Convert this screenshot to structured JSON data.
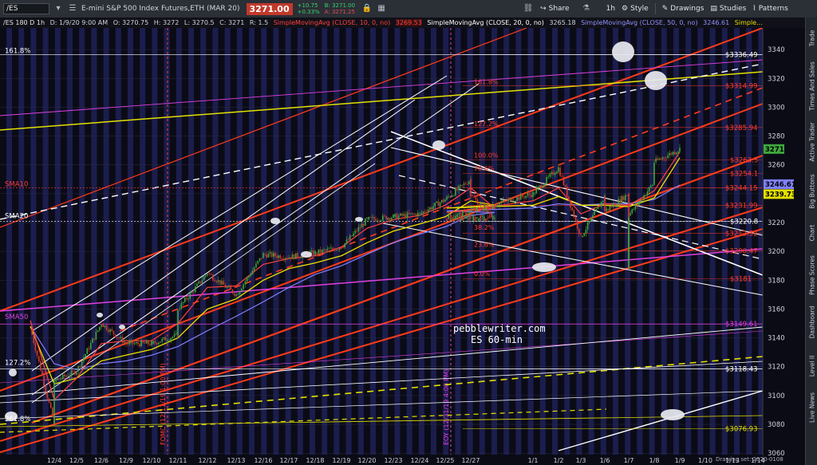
{
  "toolbar": {
    "symbol": "/ES",
    "description": "E-mini S&P 500 Index Futures,ETH (MAR 20)",
    "last_price": "3271.00",
    "change_abs": "+10.75",
    "change_pct": "+0.33%",
    "bid": "B: 3271.00",
    "ask": "A: 3271.25",
    "share": "Share",
    "timeframe": "1h",
    "style": "Style",
    "drawings": "Drawings",
    "studies": "Studies",
    "patterns": "Patterns"
  },
  "infobar": {
    "symbol_period": "/ES 180 D 1h",
    "datetime": "D: 1/9/20 9:00 AM",
    "open": "O: 3270.75",
    "high": "H: 3272",
    "low": "L: 3270.5",
    "close": "C: 3271",
    "range": "R: 1.5",
    "sma10": "SimpleMovingAvg (CLOSE, 10, 0, no)",
    "sma10_val": "3269.53",
    "sma20": "SimpleMovingAvg (CLOSE, 20, 0, no)",
    "sma20_val": "3265.18",
    "sma50": "SimpleMovingAvg (CLOSE, 50, 0, no)",
    "sma50_val": "3246.61",
    "sma_more": "Simple..."
  },
  "sidebar_tabs": [
    "Trade",
    "Times And Sales",
    "Active Trader",
    "Big Buttons",
    "Chart",
    "Phase Scores",
    "Dashboard",
    "Level II",
    "Live News"
  ],
  "status": "Drawing set: 2020-0108",
  "colors": {
    "background": "#0b0b16",
    "band": "#1f2157",
    "sma10": "#ff4040",
    "sma20": "#f0e000",
    "sma50": "#8080ff",
    "channel_red": "#ff3b1a",
    "fib": "#ff3b30",
    "magenta": "#e040e0",
    "yellow_line": "#e3e000",
    "up_candle": "#3ea83e",
    "down_candle": "#d23b2b"
  },
  "chart_data": {
    "type": "candlestick",
    "xlim": [
      "12/4",
      "1/21"
    ],
    "ylim": [
      3059,
      3355
    ],
    "x_tick_labels": [
      "12/4",
      "12/5",
      "12/6",
      "12/9",
      "12/10",
      "12/11",
      "12/12",
      "12/13",
      "12/16",
      "12/17",
      "12/18",
      "12/19",
      "12/20",
      "12/23",
      "12/24",
      "12/25",
      "12/27",
      "1/1",
      "1/2",
      "1/3",
      "1/6",
      "1/7",
      "1/8",
      "1/9",
      "1/10",
      "1/13",
      "1/14",
      "1/15",
      "1/16",
      "1/17",
      "1/20",
      "1/21"
    ],
    "y_ticks": [
      3060,
      3080,
      3100,
      3120,
      3140,
      3160,
      3180,
      3200,
      3220,
      3240,
      3260,
      3280,
      3300,
      3320,
      3340
    ],
    "price_markers": [
      {
        "label": "$3336.49",
        "value": 3336.49,
        "color": "#ffffff"
      },
      {
        "label": "$3314.99",
        "value": 3314.99,
        "color": "#ff3b30"
      },
      {
        "label": "$3285.94",
        "value": 3285.94,
        "color": "#ff3b30"
      },
      {
        "label": "$3263.5",
        "value": 3263.5,
        "color": "#ff3b30"
      },
      {
        "label": "$3254.1",
        "value": 3254.1,
        "color": "#ff3b30"
      },
      {
        "label": "$3244.15",
        "value": 3244.15,
        "color": "#ff3b30"
      },
      {
        "label": "$3231.99",
        "value": 3231.99,
        "color": "#ff3b30"
      },
      {
        "label": "$3220.8",
        "value": 3220.8,
        "color": "#ffffff"
      },
      {
        "label": "$3212.52",
        "value": 3212.52,
        "color": "#ff3b30"
      },
      {
        "label": "$3200.47",
        "value": 3200.47,
        "color": "#ff3b30"
      },
      {
        "label": "$3181",
        "value": 3181,
        "color": "#ff3b30"
      },
      {
        "label": "$3149.61",
        "value": 3149.61,
        "color": "#e040e0"
      },
      {
        "label": "$3118.43",
        "value": 3118.43,
        "color": "#ffffff"
      },
      {
        "label": "$3076.93",
        "value": 3076.93,
        "color": "#e3e000"
      }
    ],
    "current_price_tags": [
      {
        "label": "3271",
        "value": 3271,
        "color": "#3ea83e"
      },
      {
        "label": "3246.61",
        "value": 3246.61,
        "color": "#8080ff"
      },
      {
        "label": "3239.73",
        "value": 3239.73,
        "color": "#e3e000"
      }
    ],
    "left_labels": [
      {
        "text": "161.8%",
        "value": 3336.49,
        "color": "#ffffff"
      },
      {
        "text": "SMA10",
        "value": 3244.15,
        "color": "#ff3b30"
      },
      {
        "text": "SMA20",
        "value": 3222,
        "color": "#ffffff"
      },
      {
        "text": "SMA50",
        "value": 3152,
        "color": "#e040e0"
      },
      {
        "text": "127.2%",
        "value": 3120,
        "color": "#ffffff"
      },
      {
        "text": "261.8%",
        "value": 3081,
        "color": "#ffffff"
      }
    ],
    "fib_labels": [
      {
        "text": "161.8%",
        "x": "1/1",
        "value": 3316
      },
      {
        "text": "127.2%",
        "x": "1/1",
        "value": 3287
      },
      {
        "text": "100.0%",
        "x": "1/1",
        "value": 3265
      },
      {
        "text": "78.6%",
        "x": "1/1",
        "value": 3256
      },
      {
        "text": "38.2%",
        "x": "1/1",
        "value": 3215
      },
      {
        "text": "23.6%",
        "x": "1/1",
        "value": 3203
      },
      {
        "text": "0.0%",
        "x": "1/1",
        "value": 3183
      }
    ],
    "vertical_markers": [
      {
        "label": "FOMC (12/11/19 1:00 PM)",
        "x": "12/11",
        "color": "#ff3b30"
      },
      {
        "label": "EOY (12/31/19 4:00 PM)",
        "x": "12/31",
        "color": "#e040e0"
      }
    ],
    "annotations": [
      "pebblewriter.com",
      "ES 60-min"
    ],
    "price_path": [
      [
        "12/3",
        3147
      ],
      [
        "12/4",
        3080
      ],
      [
        "12/4",
        3110
      ],
      [
        "12/5",
        3117
      ],
      [
        "12/6",
        3150
      ],
      [
        "12/9",
        3136
      ],
      [
        "12/10",
        3136
      ],
      [
        "12/11",
        3142
      ],
      [
        "12/11",
        3160
      ],
      [
        "12/12",
        3185
      ],
      [
        "12/13",
        3170
      ],
      [
        "12/16",
        3198
      ],
      [
        "12/17",
        3196
      ],
      [
        "12/18",
        3199
      ],
      [
        "12/19",
        3203
      ],
      [
        "12/20",
        3222
      ],
      [
        "12/23",
        3224
      ],
      [
        "12/24",
        3226
      ],
      [
        "12/25",
        3236
      ],
      [
        "12/27",
        3250
      ],
      [
        "12/27",
        3239
      ],
      [
        "12/30",
        3223
      ],
      [
        "12/31",
        3223
      ],
      [
        "1/1",
        3240
      ],
      [
        "1/2",
        3258
      ],
      [
        "1/3",
        3210
      ],
      [
        "1/6",
        3238
      ],
      [
        "1/6",
        3228
      ],
      [
        "1/7",
        3240
      ],
      [
        "1/7",
        3188
      ],
      [
        "1/7",
        3225
      ],
      [
        "1/8",
        3248
      ],
      [
        "1/8",
        3262
      ],
      [
        "1/9",
        3271
      ]
    ],
    "sma10": [
      [
        "12/3",
        3152
      ],
      [
        "12/4",
        3097
      ],
      [
        "12/5",
        3112
      ],
      [
        "12/6",
        3136
      ],
      [
        "12/9",
        3138
      ],
      [
        "12/10",
        3138
      ],
      [
        "12/11",
        3150
      ],
      [
        "12/12",
        3175
      ],
      [
        "12/13",
        3176
      ],
      [
        "12/16",
        3191
      ],
      [
        "12/17",
        3195
      ],
      [
        "12/18",
        3197
      ],
      [
        "12/19",
        3203
      ],
      [
        "12/20",
        3216
      ],
      [
        "12/23",
        3222
      ],
      [
        "12/24",
        3225
      ],
      [
        "12/25",
        3232
      ],
      [
        "12/27",
        3244
      ],
      [
        "12/30",
        3230
      ],
      [
        "12/31",
        3227
      ],
      [
        "1/1",
        3235
      ],
      [
        "1/2",
        3244
      ],
      [
        "1/3",
        3226
      ],
      [
        "1/6",
        3233
      ],
      [
        "1/7",
        3232
      ],
      [
        "1/8",
        3242
      ],
      [
        "1/9",
        3269
      ]
    ],
    "sma20": [
      [
        "12/3",
        3148
      ],
      [
        "12/4",
        3108
      ],
      [
        "12/5",
        3112
      ],
      [
        "12/6",
        3124
      ],
      [
        "12/9",
        3128
      ],
      [
        "12/10",
        3132
      ],
      [
        "12/11",
        3140
      ],
      [
        "12/12",
        3160
      ],
      [
        "12/13",
        3167
      ],
      [
        "12/16",
        3180
      ],
      [
        "12/17",
        3188
      ],
      [
        "12/18",
        3192
      ],
      [
        "12/19",
        3197
      ],
      [
        "12/20",
        3206
      ],
      [
        "12/23",
        3214
      ],
      [
        "12/24",
        3219
      ],
      [
        "12/25",
        3224
      ],
      [
        "12/27",
        3235
      ],
      [
        "12/30",
        3232
      ],
      [
        "12/31",
        3230
      ],
      [
        "1/1",
        3232
      ],
      [
        "1/2",
        3238
      ],
      [
        "1/3",
        3232
      ],
      [
        "1/6",
        3232
      ],
      [
        "1/7",
        3231
      ],
      [
        "1/8",
        3237
      ],
      [
        "1/9",
        3265
      ]
    ],
    "sma50": [
      [
        "12/3",
        3148
      ],
      [
        "12/4",
        3122
      ],
      [
        "12/5",
        3118
      ],
      [
        "12/6",
        3122
      ],
      [
        "12/9",
        3124
      ],
      [
        "12/10",
        3128
      ],
      [
        "12/11",
        3134
      ],
      [
        "12/12",
        3145
      ],
      [
        "12/13",
        3155
      ],
      [
        "12/16",
        3165
      ],
      [
        "12/17",
        3175
      ],
      [
        "12/18",
        3184
      ],
      [
        "12/19",
        3190
      ],
      [
        "12/20",
        3198
      ],
      [
        "12/23",
        3206
      ],
      [
        "12/24",
        3212
      ],
      [
        "12/25",
        3217
      ],
      [
        "12/27",
        3225
      ],
      [
        "12/30",
        3227
      ],
      [
        "12/31",
        3228
      ],
      [
        "1/1",
        3230
      ],
      [
        "1/2",
        3233
      ],
      [
        "1/3",
        3232
      ],
      [
        "1/6",
        3233
      ],
      [
        "1/7",
        3233
      ],
      [
        "1/8",
        3236
      ],
      [
        "1/9",
        3246
      ]
    ]
  }
}
